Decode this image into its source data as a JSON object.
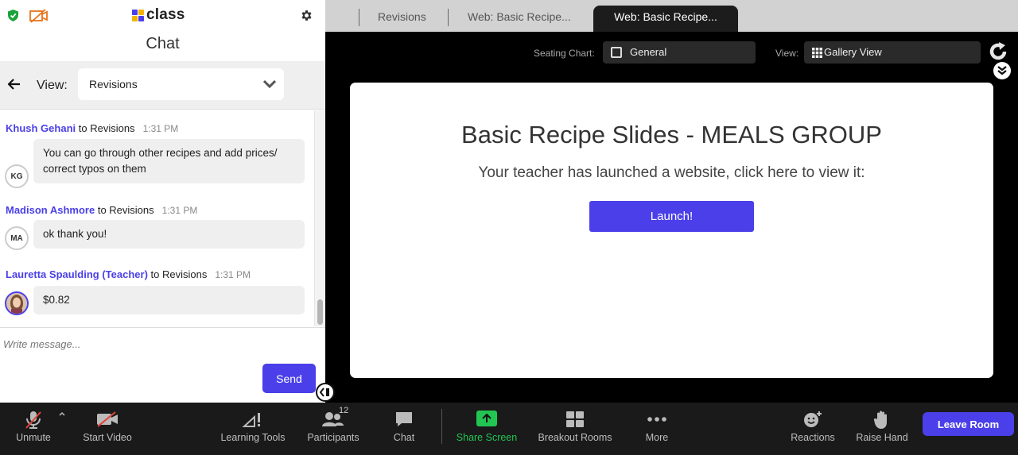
{
  "app": {
    "logo_text": "class"
  },
  "chat": {
    "title": "Chat",
    "view_label": "View:",
    "view_value": "Revisions",
    "messages": [
      {
        "sender": "Khush Gehani",
        "to": "to Revisions",
        "time": "1:31 PM",
        "initials": "KG",
        "text": "You can go through other recipes and add prices/ correct typos on them"
      },
      {
        "sender": "Madison Ashmore",
        "to": "to Revisions",
        "time": "1:31 PM",
        "initials": "MA",
        "text": "ok thank you!"
      },
      {
        "sender": "Lauretta Spaulding (Teacher)",
        "to": "to Revisions",
        "time": "1:31 PM",
        "initials": "",
        "text": "$0.82"
      }
    ],
    "input_placeholder": "Write message...",
    "send_label": "Send"
  },
  "tabs": [
    {
      "label": "Revisions"
    },
    {
      "label": "Web: Basic Recipe..."
    },
    {
      "label": "Web: Basic Recipe..."
    }
  ],
  "viewbar": {
    "seating_label": "Seating Chart:",
    "seating_value": "General",
    "view_label": "View:",
    "view_value": "Gallery View"
  },
  "card": {
    "title": "Basic Recipe Slides - MEALS GROUP",
    "subtitle": "Your teacher has launched a website, click here to view it:",
    "launch_label": "Launch!"
  },
  "toolbar": {
    "unmute": "Unmute",
    "start_video": "Start Video",
    "learning_tools": "Learning Tools",
    "participants": "Participants",
    "participants_count": "12",
    "chat": "Chat",
    "share_screen": "Share Screen",
    "breakout_rooms": "Breakout Rooms",
    "more": "More",
    "reactions": "Reactions",
    "raise_hand": "Raise Hand",
    "leave_room": "Leave Room"
  },
  "colors": {
    "accent": "#4a3fe8",
    "share_green": "#23c552",
    "muted_red": "#e0443a",
    "shield_green": "#1aa33a"
  }
}
